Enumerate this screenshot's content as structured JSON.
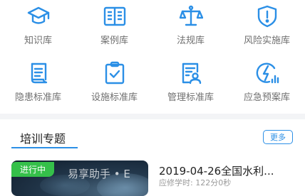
{
  "menu": [
    {
      "label": "知识库",
      "icon": "graduation-cap-icon"
    },
    {
      "label": "案例库",
      "icon": "open-book-icon"
    },
    {
      "label": "法规库",
      "icon": "scales-icon"
    },
    {
      "label": "风险实施库",
      "icon": "shield-alert-icon"
    },
    {
      "label": "隐患标准库",
      "icon": "document-scroll-icon"
    },
    {
      "label": "设施标准库",
      "icon": "clipboard-check-icon"
    },
    {
      "label": "管理标准库",
      "icon": "user-document-icon"
    },
    {
      "label": "应急预案库",
      "icon": "lightning-chart-icon"
    }
  ],
  "training": {
    "title": "培训专题",
    "more_label": "更多",
    "course": {
      "status": "进行中",
      "overlay_text": "易享助手 • E",
      "title": "2019-04-26全国水利...",
      "meta": "应修学时: 122分0秒"
    }
  },
  "colors": {
    "accent": "#2b8fe6",
    "status_green": "#35c04a"
  }
}
